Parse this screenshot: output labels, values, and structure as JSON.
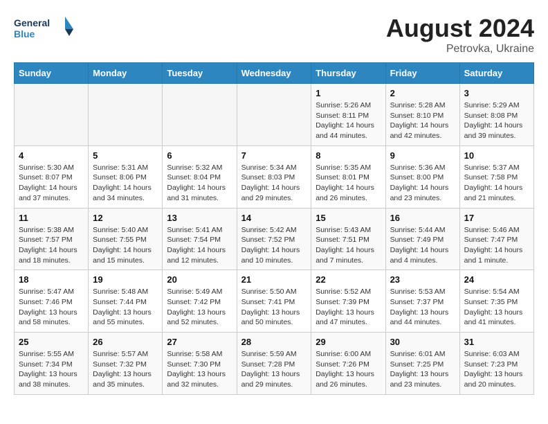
{
  "header": {
    "logo_line1": "General",
    "logo_line2": "Blue",
    "month_year": "August 2024",
    "location": "Petrovka, Ukraine"
  },
  "days_of_week": [
    "Sunday",
    "Monday",
    "Tuesday",
    "Wednesday",
    "Thursday",
    "Friday",
    "Saturday"
  ],
  "weeks": [
    [
      {
        "day": "",
        "info": ""
      },
      {
        "day": "",
        "info": ""
      },
      {
        "day": "",
        "info": ""
      },
      {
        "day": "",
        "info": ""
      },
      {
        "day": "1",
        "info": "Sunrise: 5:26 AM\nSunset: 8:11 PM\nDaylight: 14 hours\nand 44 minutes."
      },
      {
        "day": "2",
        "info": "Sunrise: 5:28 AM\nSunset: 8:10 PM\nDaylight: 14 hours\nand 42 minutes."
      },
      {
        "day": "3",
        "info": "Sunrise: 5:29 AM\nSunset: 8:08 PM\nDaylight: 14 hours\nand 39 minutes."
      }
    ],
    [
      {
        "day": "4",
        "info": "Sunrise: 5:30 AM\nSunset: 8:07 PM\nDaylight: 14 hours\nand 37 minutes."
      },
      {
        "day": "5",
        "info": "Sunrise: 5:31 AM\nSunset: 8:06 PM\nDaylight: 14 hours\nand 34 minutes."
      },
      {
        "day": "6",
        "info": "Sunrise: 5:32 AM\nSunset: 8:04 PM\nDaylight: 14 hours\nand 31 minutes."
      },
      {
        "day": "7",
        "info": "Sunrise: 5:34 AM\nSunset: 8:03 PM\nDaylight: 14 hours\nand 29 minutes."
      },
      {
        "day": "8",
        "info": "Sunrise: 5:35 AM\nSunset: 8:01 PM\nDaylight: 14 hours\nand 26 minutes."
      },
      {
        "day": "9",
        "info": "Sunrise: 5:36 AM\nSunset: 8:00 PM\nDaylight: 14 hours\nand 23 minutes."
      },
      {
        "day": "10",
        "info": "Sunrise: 5:37 AM\nSunset: 7:58 PM\nDaylight: 14 hours\nand 21 minutes."
      }
    ],
    [
      {
        "day": "11",
        "info": "Sunrise: 5:38 AM\nSunset: 7:57 PM\nDaylight: 14 hours\nand 18 minutes."
      },
      {
        "day": "12",
        "info": "Sunrise: 5:40 AM\nSunset: 7:55 PM\nDaylight: 14 hours\nand 15 minutes."
      },
      {
        "day": "13",
        "info": "Sunrise: 5:41 AM\nSunset: 7:54 PM\nDaylight: 14 hours\nand 12 minutes."
      },
      {
        "day": "14",
        "info": "Sunrise: 5:42 AM\nSunset: 7:52 PM\nDaylight: 14 hours\nand 10 minutes."
      },
      {
        "day": "15",
        "info": "Sunrise: 5:43 AM\nSunset: 7:51 PM\nDaylight: 14 hours\nand 7 minutes."
      },
      {
        "day": "16",
        "info": "Sunrise: 5:44 AM\nSunset: 7:49 PM\nDaylight: 14 hours\nand 4 minutes."
      },
      {
        "day": "17",
        "info": "Sunrise: 5:46 AM\nSunset: 7:47 PM\nDaylight: 14 hours\nand 1 minute."
      }
    ],
    [
      {
        "day": "18",
        "info": "Sunrise: 5:47 AM\nSunset: 7:46 PM\nDaylight: 13 hours\nand 58 minutes."
      },
      {
        "day": "19",
        "info": "Sunrise: 5:48 AM\nSunset: 7:44 PM\nDaylight: 13 hours\nand 55 minutes."
      },
      {
        "day": "20",
        "info": "Sunrise: 5:49 AM\nSunset: 7:42 PM\nDaylight: 13 hours\nand 52 minutes."
      },
      {
        "day": "21",
        "info": "Sunrise: 5:50 AM\nSunset: 7:41 PM\nDaylight: 13 hours\nand 50 minutes."
      },
      {
        "day": "22",
        "info": "Sunrise: 5:52 AM\nSunset: 7:39 PM\nDaylight: 13 hours\nand 47 minutes."
      },
      {
        "day": "23",
        "info": "Sunrise: 5:53 AM\nSunset: 7:37 PM\nDaylight: 13 hours\nand 44 minutes."
      },
      {
        "day": "24",
        "info": "Sunrise: 5:54 AM\nSunset: 7:35 PM\nDaylight: 13 hours\nand 41 minutes."
      }
    ],
    [
      {
        "day": "25",
        "info": "Sunrise: 5:55 AM\nSunset: 7:34 PM\nDaylight: 13 hours\nand 38 minutes."
      },
      {
        "day": "26",
        "info": "Sunrise: 5:57 AM\nSunset: 7:32 PM\nDaylight: 13 hours\nand 35 minutes."
      },
      {
        "day": "27",
        "info": "Sunrise: 5:58 AM\nSunset: 7:30 PM\nDaylight: 13 hours\nand 32 minutes."
      },
      {
        "day": "28",
        "info": "Sunrise: 5:59 AM\nSunset: 7:28 PM\nDaylight: 13 hours\nand 29 minutes."
      },
      {
        "day": "29",
        "info": "Sunrise: 6:00 AM\nSunset: 7:26 PM\nDaylight: 13 hours\nand 26 minutes."
      },
      {
        "day": "30",
        "info": "Sunrise: 6:01 AM\nSunset: 7:25 PM\nDaylight: 13 hours\nand 23 minutes."
      },
      {
        "day": "31",
        "info": "Sunrise: 6:03 AM\nSunset: 7:23 PM\nDaylight: 13 hours\nand 20 minutes."
      }
    ]
  ]
}
